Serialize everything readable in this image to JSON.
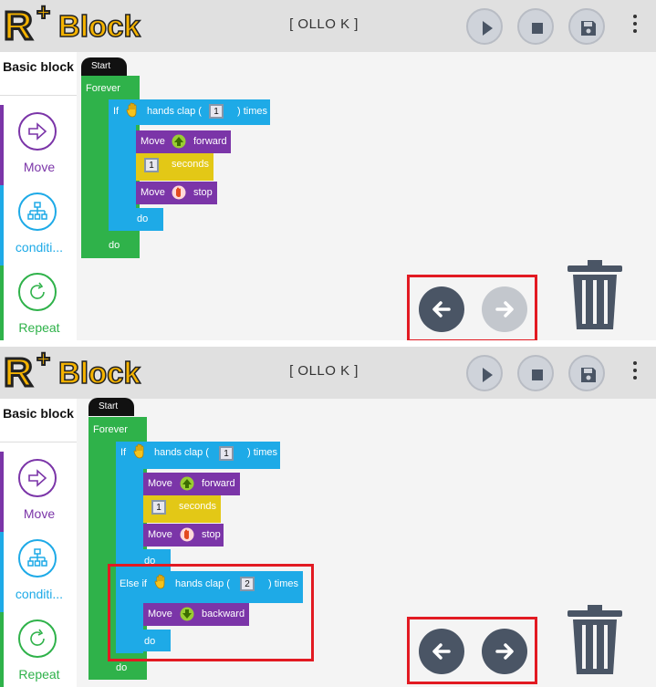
{
  "app": {
    "logo_r": "R",
    "logo_plus": "+",
    "logo_text": "Block",
    "title": "[ OLLO K ]",
    "toolbar_icons": [
      "play-icon",
      "stop-icon",
      "save-icon",
      "more-vertical-icon"
    ]
  },
  "sidebar": {
    "basic": "Basic block",
    "items": [
      {
        "label": "Move",
        "color": "#7b35a8",
        "icon": "arrow-right-icon"
      },
      {
        "label": "conditi...",
        "color": "#1eaae7",
        "icon": "hierarchy-icon"
      },
      {
        "label": "Repeat",
        "color": "#2fb24a",
        "icon": "repeat-icon"
      }
    ]
  },
  "blocks": {
    "start": "Start",
    "forever": "Forever",
    "if": "If",
    "else_if": "Else if",
    "hands_clap": "hands clap (",
    "times": ") times",
    "clap_count_1": "1",
    "clap_count_2": "2",
    "move": "Move",
    "forward": "forward",
    "seconds_value": "1",
    "seconds": "seconds",
    "stop": "stop",
    "backward": "backward",
    "do": "do"
  },
  "colors": {
    "green": "#2fb24a",
    "blue": "#1eaae7",
    "purple": "#7b35a8",
    "yellow": "#e3c816",
    "highlight": "#e21a22",
    "nav_active": "#4a5565",
    "nav_disabled": "#c3c7cd"
  },
  "screens": [
    {
      "undo_enabled": true,
      "redo_enabled": false
    },
    {
      "undo_enabled": true,
      "redo_enabled": true
    }
  ]
}
